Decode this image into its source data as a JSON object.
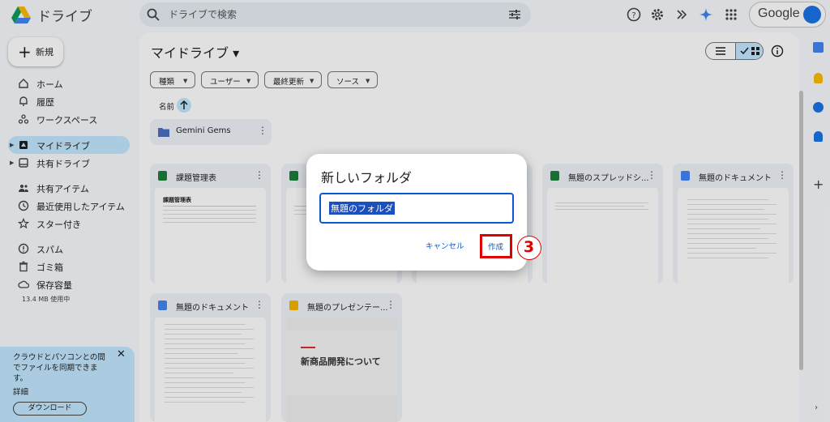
{
  "header": {
    "app_title": "ドライブ",
    "search_placeholder": "ドライブで検索",
    "account_label": "Google"
  },
  "sidebar": {
    "new_label": "新規",
    "items": [
      {
        "label": "ホーム",
        "icon": "home-icon"
      },
      {
        "label": "履歴",
        "icon": "bell-icon"
      },
      {
        "label": "ワークスペース",
        "icon": "workspace-icon"
      },
      {
        "label": "マイドライブ",
        "icon": "drive-icon",
        "active": true
      },
      {
        "label": "共有ドライブ",
        "icon": "shared-drive-icon"
      },
      {
        "label": "共有アイテム",
        "icon": "people-icon"
      },
      {
        "label": "最近使用したアイテム",
        "icon": "clock-icon"
      },
      {
        "label": "スター付き",
        "icon": "star-icon"
      },
      {
        "label": "スパム",
        "icon": "spam-icon"
      },
      {
        "label": "ゴミ箱",
        "icon": "trash-icon"
      },
      {
        "label": "保存容量",
        "icon": "cloud-icon"
      }
    ],
    "storage_usage": "13.4 MB 使用中",
    "promo": {
      "text": "クラウドとパソコンとの間でファイルを同期できます。",
      "link": "詳細",
      "button": "ダウンロード"
    }
  },
  "main": {
    "title": "マイドライブ",
    "filters": [
      "種類",
      "ユーザー",
      "最終更新",
      "ソース"
    ],
    "sort_label": "名前",
    "folder": {
      "name": "Gemini Gems"
    },
    "files": [
      {
        "name": "課題管理表",
        "type": "sheet",
        "thumb_heading": "課題管理表"
      },
      {
        "name": "",
        "type": "sheet"
      },
      {
        "name": "",
        "type": "sheet"
      },
      {
        "name": "無題のスプレッドシ...",
        "type": "sheet"
      },
      {
        "name": "無題のドキュメント",
        "type": "doc"
      },
      {
        "name": "無題のドキュメント",
        "type": "doc"
      },
      {
        "name": "無題のプレゼンテー...",
        "type": "slide",
        "thumb_heading": "新商品開発について"
      }
    ]
  },
  "dialog": {
    "title": "新しいフォルダ",
    "input_value": "無題のフォルダ",
    "cancel_label": "キャンセル",
    "create_label": "作成",
    "step_number": "3"
  },
  "colors": {
    "accent": "#0b57d0",
    "highlight": "#c2e7ff",
    "annotation_red": "#e00000",
    "sheet_green": "#188038",
    "doc_blue": "#4285f4",
    "slide_yellow": "#f4b400"
  }
}
